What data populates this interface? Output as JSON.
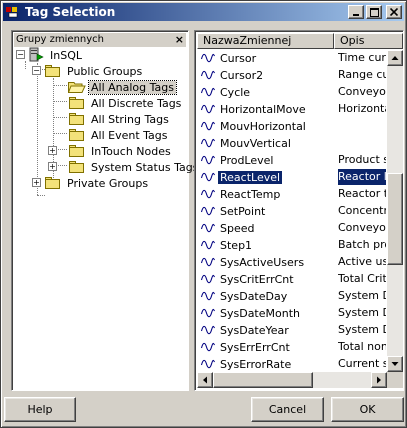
{
  "window": {
    "title": "Tag Selection",
    "icon": "insql-app-icon"
  },
  "tree": {
    "header": "Grupy zmiennych",
    "close_glyph": "×",
    "nodes": [
      {
        "label": "InSQL",
        "icon": "server-icon",
        "expander": "−"
      },
      {
        "label": "Public Groups",
        "icon": "folder-icon",
        "expander": "−"
      },
      {
        "label": "All Analog Tags",
        "icon": "folder-icon",
        "expander": ""
      },
      {
        "label": "All Discrete Tags",
        "icon": "folder-icon",
        "expander": ""
      },
      {
        "label": "All String Tags",
        "icon": "folder-icon",
        "expander": ""
      },
      {
        "label": "All Event Tags",
        "icon": "folder-icon",
        "expander": ""
      },
      {
        "label": "InTouch Nodes",
        "icon": "folder-icon",
        "expander": "+"
      },
      {
        "label": "System Status Tags",
        "icon": "folder-icon",
        "expander": "+"
      },
      {
        "label": "Private Groups",
        "icon": "folder-icon",
        "expander": "+"
      }
    ]
  },
  "list": {
    "columns": [
      "NazwaZmiennej",
      "Opis"
    ],
    "rows": [
      {
        "name": "Cursor",
        "desc": "Time curs"
      },
      {
        "name": "Cursor2",
        "desc": "Range cu"
      },
      {
        "name": "Cycle",
        "desc": "Conveyor"
      },
      {
        "name": "HorizontalMove",
        "desc": "Horizontal"
      },
      {
        "name": "MouvHorizontal",
        "desc": ""
      },
      {
        "name": "MouvVertical",
        "desc": ""
      },
      {
        "name": "ProdLevel",
        "desc": "Product st"
      },
      {
        "name": "ReactLevel",
        "desc": "Reactor l."
      },
      {
        "name": "ReactTemp",
        "desc": "Reactor t."
      },
      {
        "name": "SetPoint",
        "desc": "Concentr."
      },
      {
        "name": "Speed",
        "desc": "Conveyor"
      },
      {
        "name": "Step1",
        "desc": "Batch pro"
      },
      {
        "name": "SysActiveUsers",
        "desc": "Active us."
      },
      {
        "name": "SysCritErrCnt",
        "desc": "Total Criti."
      },
      {
        "name": "SysDateDay",
        "desc": "System D."
      },
      {
        "name": "SysDateMonth",
        "desc": "System D."
      },
      {
        "name": "SysDateYear",
        "desc": "System D."
      },
      {
        "name": "SysErrErrCnt",
        "desc": "Total non-"
      },
      {
        "name": "SysErrorRate",
        "desc": "Current sy"
      }
    ]
  },
  "buttons": {
    "help": "Help",
    "cancel": "Cancel",
    "ok": "OK"
  },
  "colors": {
    "selection": "#0a246a",
    "titlebar": "#0a246a",
    "face": "#d4d0c8"
  }
}
